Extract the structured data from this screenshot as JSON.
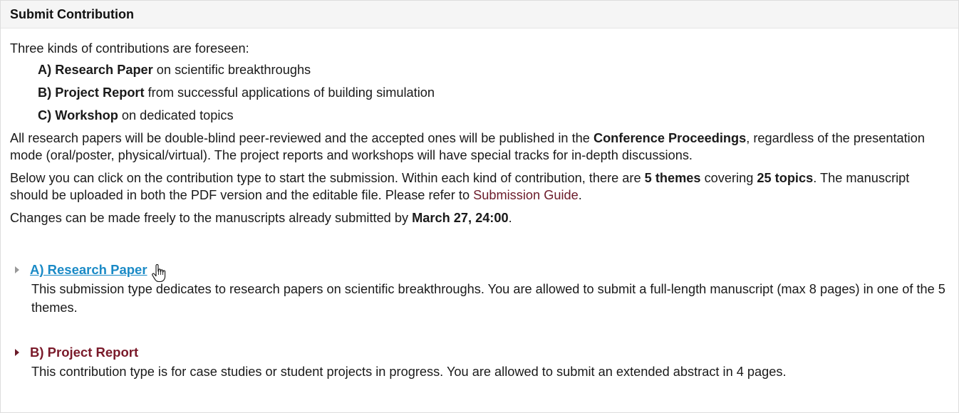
{
  "header": {
    "title": "Submit Contribution"
  },
  "intro": "Three kinds of contributions are foreseen:",
  "kinds": [
    {
      "code": "A) Research Paper",
      "rest": " on scientific breakthroughs"
    },
    {
      "code": "B) Project Report",
      "rest": " from successful applications of building simulation"
    },
    {
      "code": "C) Workshop",
      "rest": " on dedicated topics"
    }
  ],
  "para1": {
    "before": "All research papers will be double-blind peer-reviewed and the accepted ones will be published in the ",
    "bold": "Conference Proceedings",
    "after": ", regardless of the presentation mode (oral/poster, physical/virtual). The project reports and workshops will have special tracks for in-depth discussions."
  },
  "para2": {
    "a": "Below you can click on the contribution type to start the submission. Within each kind of contribution, there are ",
    "b1": "5 themes",
    "c": " covering ",
    "b2": "25 topics",
    "d": ". The manuscript should be uploaded in both the PDF version and the editable file. Please refer to ",
    "link": "Submission Guide",
    "e": "."
  },
  "para3": {
    "before": "Changes can be made freely to the manuscripts already submitted by ",
    "bold": "March 27, 24:00",
    "after": "."
  },
  "sections": [
    {
      "title": "A) Research Paper",
      "desc": "This submission type dedicates to research papers on scientific breakthroughs. You are allowed to submit a full-length manuscript (max 8 pages) in one of the 5 themes."
    },
    {
      "title": "B) Project Report",
      "desc": "This contribution type is for case studies or student projects in progress. You are allowed to submit an extended abstract in 4 pages."
    }
  ],
  "colors": {
    "link_blue": "#1a8ac6",
    "maroon": "#7a1a2a",
    "header_bg": "#f5f5f5"
  },
  "icons": [
    "caret-right-icon",
    "hand-pointer-cursor-icon"
  ]
}
